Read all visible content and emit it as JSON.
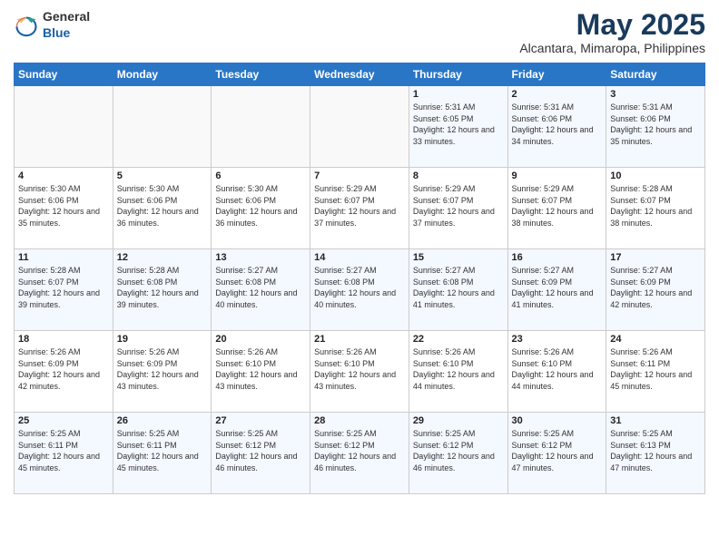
{
  "header": {
    "logo_general": "General",
    "logo_blue": "Blue",
    "month": "May 2025",
    "location": "Alcantara, Mimaropa, Philippines"
  },
  "days_of_week": [
    "Sunday",
    "Monday",
    "Tuesday",
    "Wednesday",
    "Thursday",
    "Friday",
    "Saturday"
  ],
  "weeks": [
    [
      {
        "day": "",
        "sunrise": "",
        "sunset": "",
        "daylight": ""
      },
      {
        "day": "",
        "sunrise": "",
        "sunset": "",
        "daylight": ""
      },
      {
        "day": "",
        "sunrise": "",
        "sunset": "",
        "daylight": ""
      },
      {
        "day": "",
        "sunrise": "",
        "sunset": "",
        "daylight": ""
      },
      {
        "day": "1",
        "sunrise": "Sunrise: 5:31 AM",
        "sunset": "Sunset: 6:05 PM",
        "daylight": "Daylight: 12 hours and 33 minutes."
      },
      {
        "day": "2",
        "sunrise": "Sunrise: 5:31 AM",
        "sunset": "Sunset: 6:06 PM",
        "daylight": "Daylight: 12 hours and 34 minutes."
      },
      {
        "day": "3",
        "sunrise": "Sunrise: 5:31 AM",
        "sunset": "Sunset: 6:06 PM",
        "daylight": "Daylight: 12 hours and 35 minutes."
      }
    ],
    [
      {
        "day": "4",
        "sunrise": "Sunrise: 5:30 AM",
        "sunset": "Sunset: 6:06 PM",
        "daylight": "Daylight: 12 hours and 35 minutes."
      },
      {
        "day": "5",
        "sunrise": "Sunrise: 5:30 AM",
        "sunset": "Sunset: 6:06 PM",
        "daylight": "Daylight: 12 hours and 36 minutes."
      },
      {
        "day": "6",
        "sunrise": "Sunrise: 5:30 AM",
        "sunset": "Sunset: 6:06 PM",
        "daylight": "Daylight: 12 hours and 36 minutes."
      },
      {
        "day": "7",
        "sunrise": "Sunrise: 5:29 AM",
        "sunset": "Sunset: 6:07 PM",
        "daylight": "Daylight: 12 hours and 37 minutes."
      },
      {
        "day": "8",
        "sunrise": "Sunrise: 5:29 AM",
        "sunset": "Sunset: 6:07 PM",
        "daylight": "Daylight: 12 hours and 37 minutes."
      },
      {
        "day": "9",
        "sunrise": "Sunrise: 5:29 AM",
        "sunset": "Sunset: 6:07 PM",
        "daylight": "Daylight: 12 hours and 38 minutes."
      },
      {
        "day": "10",
        "sunrise": "Sunrise: 5:28 AM",
        "sunset": "Sunset: 6:07 PM",
        "daylight": "Daylight: 12 hours and 38 minutes."
      }
    ],
    [
      {
        "day": "11",
        "sunrise": "Sunrise: 5:28 AM",
        "sunset": "Sunset: 6:07 PM",
        "daylight": "Daylight: 12 hours and 39 minutes."
      },
      {
        "day": "12",
        "sunrise": "Sunrise: 5:28 AM",
        "sunset": "Sunset: 6:08 PM",
        "daylight": "Daylight: 12 hours and 39 minutes."
      },
      {
        "day": "13",
        "sunrise": "Sunrise: 5:27 AM",
        "sunset": "Sunset: 6:08 PM",
        "daylight": "Daylight: 12 hours and 40 minutes."
      },
      {
        "day": "14",
        "sunrise": "Sunrise: 5:27 AM",
        "sunset": "Sunset: 6:08 PM",
        "daylight": "Daylight: 12 hours and 40 minutes."
      },
      {
        "day": "15",
        "sunrise": "Sunrise: 5:27 AM",
        "sunset": "Sunset: 6:08 PM",
        "daylight": "Daylight: 12 hours and 41 minutes."
      },
      {
        "day": "16",
        "sunrise": "Sunrise: 5:27 AM",
        "sunset": "Sunset: 6:09 PM",
        "daylight": "Daylight: 12 hours and 41 minutes."
      },
      {
        "day": "17",
        "sunrise": "Sunrise: 5:27 AM",
        "sunset": "Sunset: 6:09 PM",
        "daylight": "Daylight: 12 hours and 42 minutes."
      }
    ],
    [
      {
        "day": "18",
        "sunrise": "Sunrise: 5:26 AM",
        "sunset": "Sunset: 6:09 PM",
        "daylight": "Daylight: 12 hours and 42 minutes."
      },
      {
        "day": "19",
        "sunrise": "Sunrise: 5:26 AM",
        "sunset": "Sunset: 6:09 PM",
        "daylight": "Daylight: 12 hours and 43 minutes."
      },
      {
        "day": "20",
        "sunrise": "Sunrise: 5:26 AM",
        "sunset": "Sunset: 6:10 PM",
        "daylight": "Daylight: 12 hours and 43 minutes."
      },
      {
        "day": "21",
        "sunrise": "Sunrise: 5:26 AM",
        "sunset": "Sunset: 6:10 PM",
        "daylight": "Daylight: 12 hours and 43 minutes."
      },
      {
        "day": "22",
        "sunrise": "Sunrise: 5:26 AM",
        "sunset": "Sunset: 6:10 PM",
        "daylight": "Daylight: 12 hours and 44 minutes."
      },
      {
        "day": "23",
        "sunrise": "Sunrise: 5:26 AM",
        "sunset": "Sunset: 6:10 PM",
        "daylight": "Daylight: 12 hours and 44 minutes."
      },
      {
        "day": "24",
        "sunrise": "Sunrise: 5:26 AM",
        "sunset": "Sunset: 6:11 PM",
        "daylight": "Daylight: 12 hours and 45 minutes."
      }
    ],
    [
      {
        "day": "25",
        "sunrise": "Sunrise: 5:25 AM",
        "sunset": "Sunset: 6:11 PM",
        "daylight": "Daylight: 12 hours and 45 minutes."
      },
      {
        "day": "26",
        "sunrise": "Sunrise: 5:25 AM",
        "sunset": "Sunset: 6:11 PM",
        "daylight": "Daylight: 12 hours and 45 minutes."
      },
      {
        "day": "27",
        "sunrise": "Sunrise: 5:25 AM",
        "sunset": "Sunset: 6:12 PM",
        "daylight": "Daylight: 12 hours and 46 minutes."
      },
      {
        "day": "28",
        "sunrise": "Sunrise: 5:25 AM",
        "sunset": "Sunset: 6:12 PM",
        "daylight": "Daylight: 12 hours and 46 minutes."
      },
      {
        "day": "29",
        "sunrise": "Sunrise: 5:25 AM",
        "sunset": "Sunset: 6:12 PM",
        "daylight": "Daylight: 12 hours and 46 minutes."
      },
      {
        "day": "30",
        "sunrise": "Sunrise: 5:25 AM",
        "sunset": "Sunset: 6:12 PM",
        "daylight": "Daylight: 12 hours and 47 minutes."
      },
      {
        "day": "31",
        "sunrise": "Sunrise: 5:25 AM",
        "sunset": "Sunset: 6:13 PM",
        "daylight": "Daylight: 12 hours and 47 minutes."
      }
    ]
  ]
}
